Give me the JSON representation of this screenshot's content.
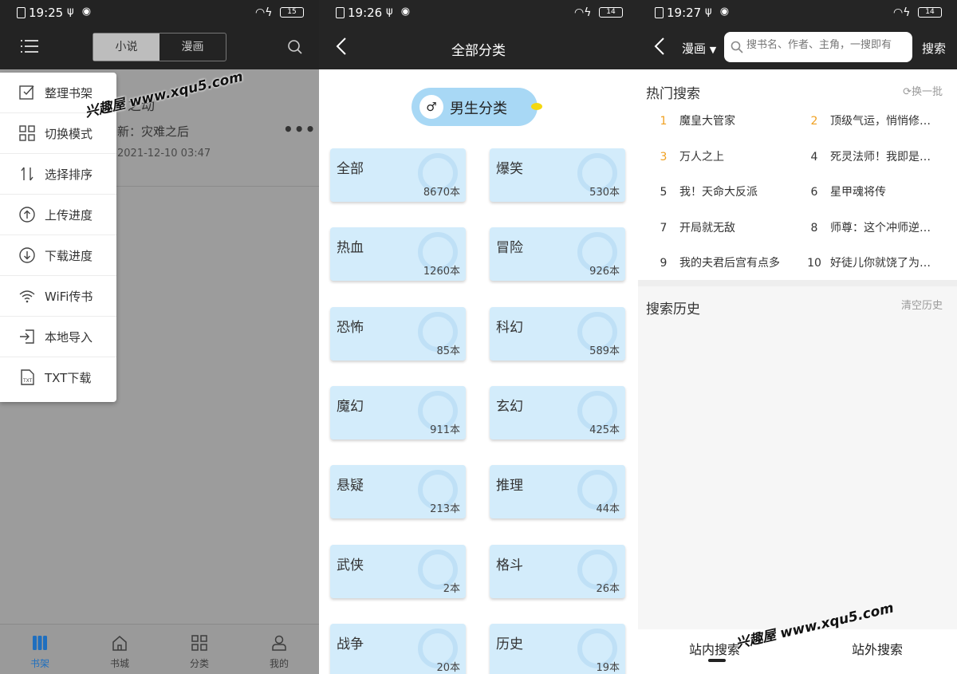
{
  "screens": [
    {
      "status": {
        "time": "19:25",
        "battery": "15"
      },
      "tabs": [
        "小说",
        "漫画"
      ],
      "book": {
        "title_fragment": "之动",
        "latest": "新：灾难之后",
        "date": "2021-12-10 03:47"
      },
      "menu": [
        "整理书架",
        "切换模式",
        "选择排序",
        "上传进度",
        "下载进度",
        "WiFi传书",
        "本地导入",
        "TXT下载"
      ],
      "bottom_nav": [
        "书架",
        "书城",
        "分类",
        "我的"
      ]
    },
    {
      "status": {
        "time": "19:26",
        "battery": "14"
      },
      "title": "全部分类",
      "pill": "男生分类",
      "categories": [
        {
          "name": "全部",
          "count": "8670本"
        },
        {
          "name": "爆笑",
          "count": "530本"
        },
        {
          "name": "热血",
          "count": "1260本"
        },
        {
          "name": "冒险",
          "count": "926本"
        },
        {
          "name": "恐怖",
          "count": "85本"
        },
        {
          "name": "科幻",
          "count": "589本"
        },
        {
          "name": "魔幻",
          "count": "911本"
        },
        {
          "name": "玄幻",
          "count": "425本"
        },
        {
          "name": "悬疑",
          "count": "213本"
        },
        {
          "name": "推理",
          "count": "44本"
        },
        {
          "name": "武侠",
          "count": "2本"
        },
        {
          "name": "格斗",
          "count": "26本"
        },
        {
          "name": "战争",
          "count": "20本"
        },
        {
          "name": "历史",
          "count": "19本"
        }
      ]
    },
    {
      "status": {
        "time": "19:27",
        "battery": "14"
      },
      "dropdown": "漫画",
      "search_placeholder": "搜书名、作者、主角，一搜即有",
      "search_btn": "搜索",
      "hot_title": "热门搜索",
      "refresh": "换一批",
      "hot": [
        {
          "n": "1",
          "t": "魔皇大管家"
        },
        {
          "n": "2",
          "t": "顶级气运，悄悄修…"
        },
        {
          "n": "3",
          "t": "万人之上"
        },
        {
          "n": "4",
          "t": "死灵法师！我即是…"
        },
        {
          "n": "5",
          "t": "我！天命大反派"
        },
        {
          "n": "6",
          "t": "星甲魂将传"
        },
        {
          "n": "7",
          "t": "开局就无敌"
        },
        {
          "n": "8",
          "t": "师尊：这个冲师逆…"
        },
        {
          "n": "9",
          "t": "我的夫君后宫有点多"
        },
        {
          "n": "10",
          "t": "好徒儿你就饶了为…"
        }
      ],
      "history_title": "搜索历史",
      "clear": "清空历史",
      "bottom_tabs": [
        "站内搜索",
        "站外搜索"
      ]
    }
  ],
  "watermarks": [
    "兴趣屋 www.xqu5.com",
    "兴趣屋 www.xqu5.com"
  ]
}
